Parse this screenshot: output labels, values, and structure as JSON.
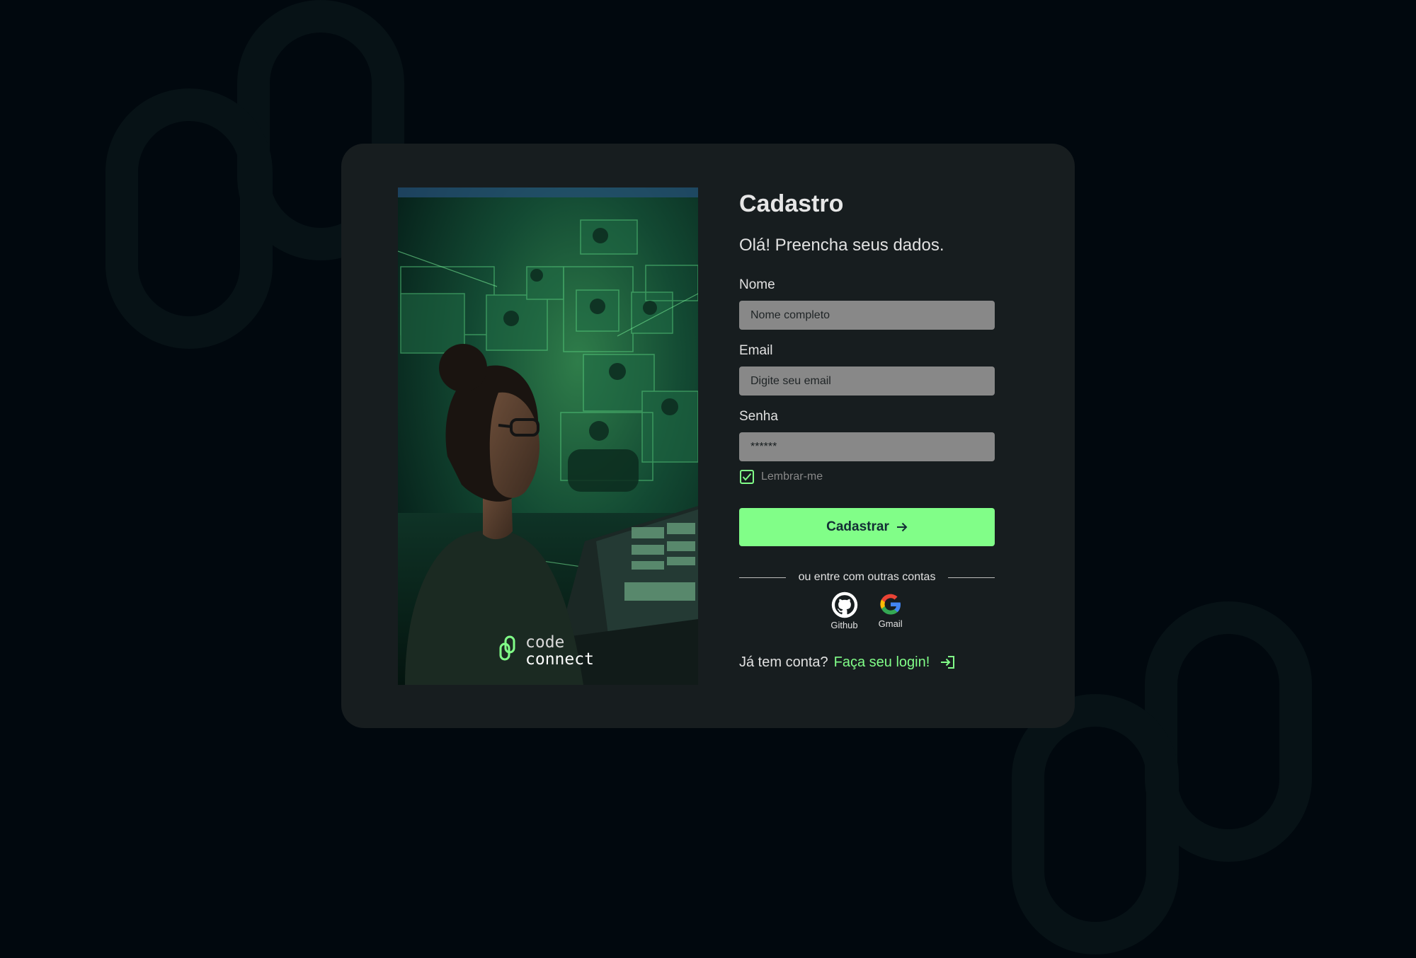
{
  "colors": {
    "page_bg": "#01080e",
    "card_bg": "#171d1f",
    "accent": "#81fe88",
    "input_bg": "#888888",
    "text": "#e1e1e1"
  },
  "hero": {
    "image": "woman-at-laptop-with-green-holographic-screens",
    "brand_top": "code",
    "brand_bottom": "connect"
  },
  "form": {
    "title": "Cadastro",
    "subtitle": "Olá! Preencha seus dados.",
    "name_label": "Nome",
    "name_placeholder": "Nome completo",
    "email_label": "Email",
    "email_placeholder": "Digite seu email",
    "password_label": "Senha",
    "password_value": "******",
    "remember_label": "Lembrar-me",
    "remember_checked": true,
    "submit_label": "Cadastrar",
    "divider_text": "ou entre com outras contas",
    "socials": [
      {
        "label": "Github",
        "icon": "github-icon"
      },
      {
        "label": "Gmail",
        "icon": "google-icon"
      }
    ],
    "login_question": "Já tem conta?",
    "login_link": "Faça seu login!"
  }
}
